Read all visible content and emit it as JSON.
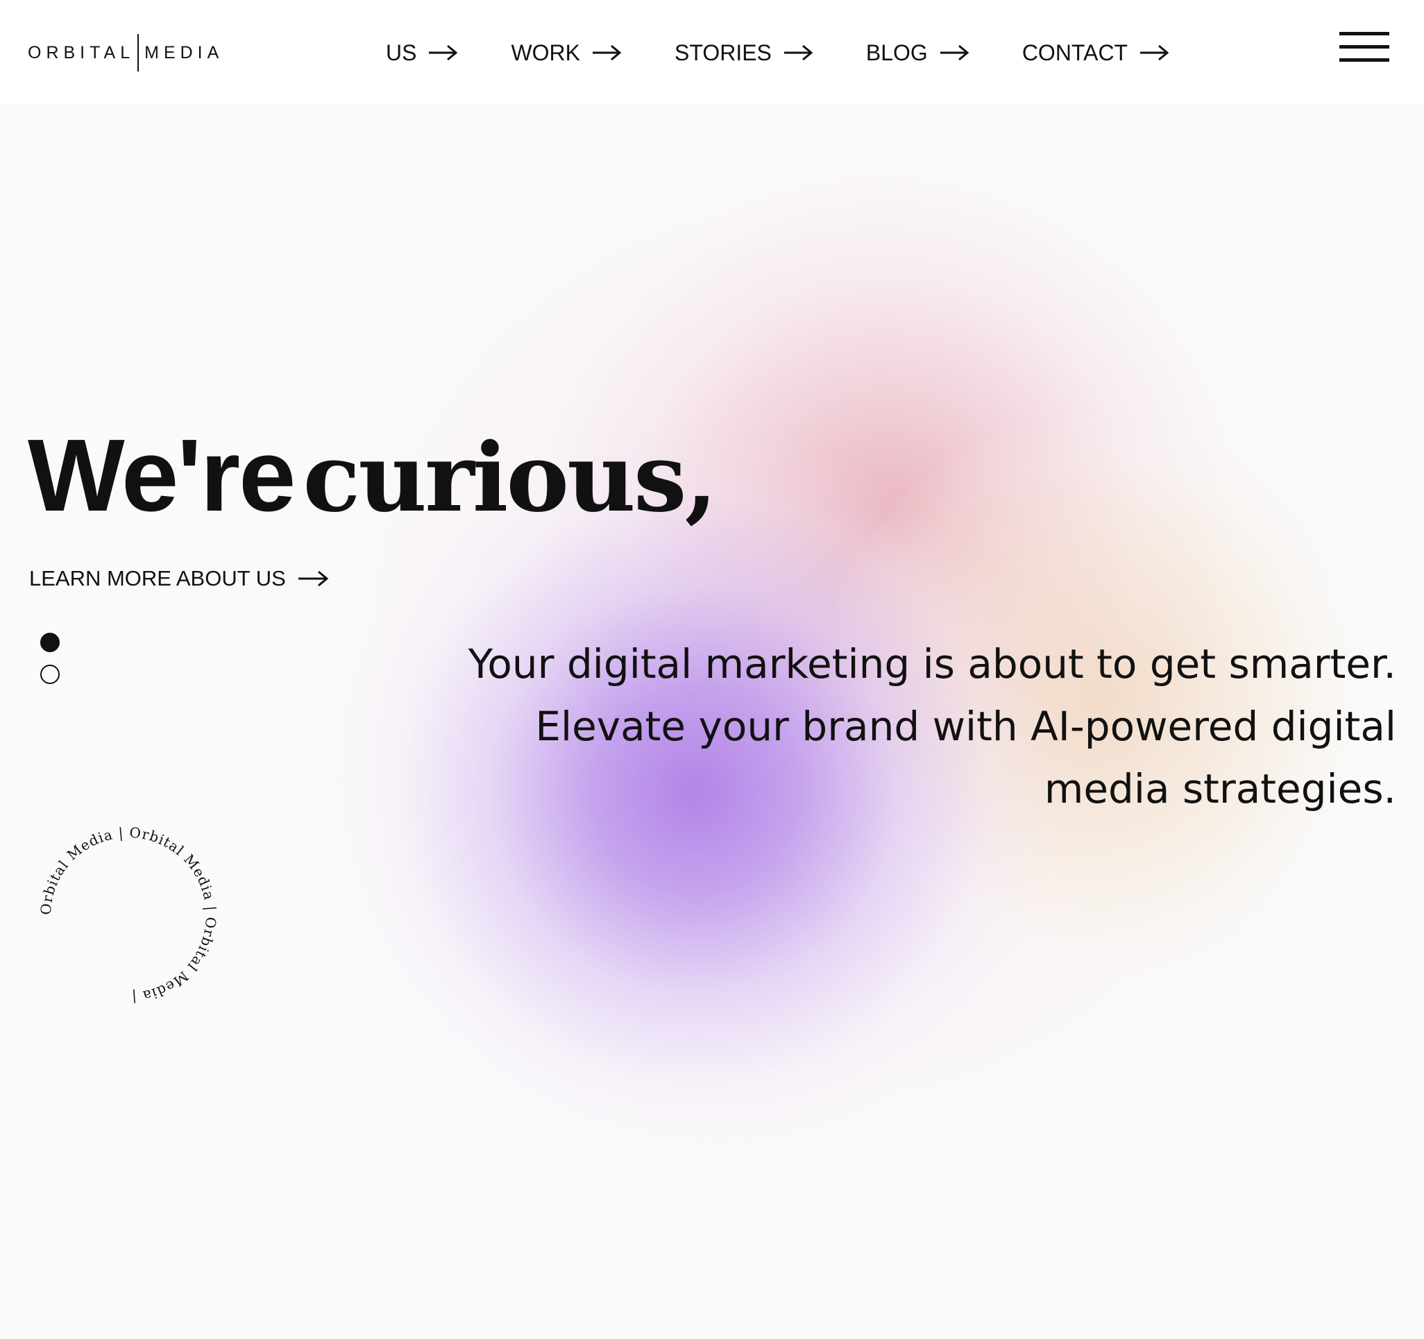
{
  "brand": {
    "left": "ORBITAL",
    "right": "MEDIA"
  },
  "nav": {
    "items": [
      {
        "label": "US",
        "icon": "arrow-right-icon"
      },
      {
        "label": "WORK",
        "icon": "arrow-right-icon"
      },
      {
        "label": "STORIES",
        "icon": "arrow-right-icon"
      },
      {
        "label": "BLOG",
        "icon": "arrow-right-icon"
      },
      {
        "label": "CONTACT",
        "icon": "arrow-right-icon"
      }
    ],
    "menu_icon": "hamburger-menu-icon"
  },
  "hero": {
    "title_sans": "We're",
    "title_serif": "curious,",
    "cta_label": "LEARN MORE ABOUT US",
    "cta_icon": "arrow-right-icon",
    "slides": {
      "count": 2,
      "active": 1
    },
    "tagline": "Your digital marketing is about to get smarter. Elevate your brand with AI-powered digital media strategies.",
    "badge_text": "Orbital Media | Orbital Media | Orbital Media | "
  },
  "colors": {
    "text": "#111111",
    "background": "#fafafa",
    "gradient_purple": "#b284e8",
    "gradient_pink": "#e8b0ba",
    "gradient_peach": "#f0d6bc"
  }
}
